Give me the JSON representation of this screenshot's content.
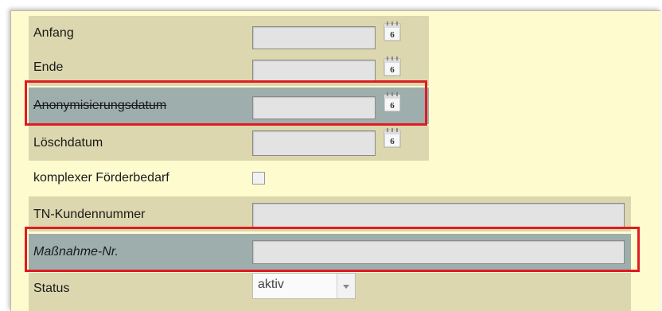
{
  "form": {
    "anfang_label": "Anfang",
    "ende_label": "Ende",
    "anonymisierung_label": "Anonymisierungsdatum",
    "loeschdatum_label": "Löschdatum",
    "komplexer_label": "komplexer Förderbedarf",
    "kundennummer_label": "TN-Kundennummer",
    "massnahme_label": "Maßnahme-Nr.",
    "status_label": "Status",
    "status_value": "aktiv",
    "calendar_icon_text": "6"
  },
  "colors": {
    "panel_bg": "#fefbcf",
    "row_khaki": "#dcd7ae",
    "row_slate": "#9daeac",
    "highlight": "#e01b22"
  }
}
